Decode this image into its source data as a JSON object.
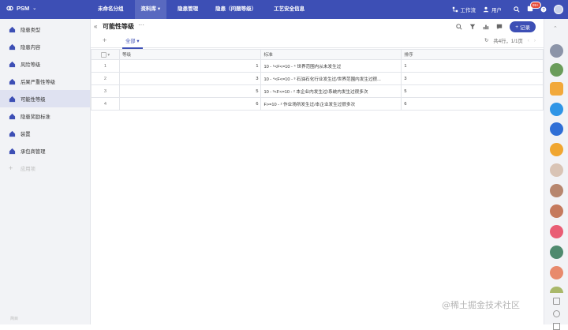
{
  "app": {
    "name": "PSM"
  },
  "nav": [
    "未命名分组",
    "资料库",
    "隐患管理",
    "隐患（问题等级）",
    "工艺安全信息"
  ],
  "topright": {
    "workflow": "工作流",
    "users": "用户",
    "badge": "99+"
  },
  "sidebar": {
    "items": [
      "隐患类型",
      "隐患内容",
      "风险等级",
      "后果严重性等级",
      "可能性等级",
      "隐患奖励标准",
      "装置",
      "承包商管理"
    ],
    "add": "应用项",
    "footer": "简目"
  },
  "page": {
    "title": "可能性等级",
    "more": "···",
    "record_button": "记录"
  },
  "tabs": {
    "all": "全部"
  },
  "pager": {
    "text": "共4行，1/1页"
  },
  "table": {
    "headers": [
      "等级",
      "标准",
      "排序"
    ],
    "rows": [
      {
        "num": "1",
        "grade": "1",
        "standard": "10 - ⁵<F<=10 - ⁴ 世界范围内从未发生过",
        "order": "1"
      },
      {
        "num": "2",
        "grade": "3",
        "standard": "10 - ⁴<F<=10 - ³ 石油石化行业发生过/世界范围内发生过很...",
        "order": "3"
      },
      {
        "num": "3",
        "grade": "5",
        "standard": "10 - ³<F<=10 - ² 本企业内发生过/系统内发生过很多次",
        "order": "5"
      },
      {
        "num": "4",
        "grade": "6",
        "standard": "F>=10 - ² 作业场所发生过/本企业发生过很多次",
        "order": "6"
      }
    ]
  },
  "watermark": "@稀土掘金技术社区",
  "colors": {
    "primary": "#3d4fb5"
  }
}
